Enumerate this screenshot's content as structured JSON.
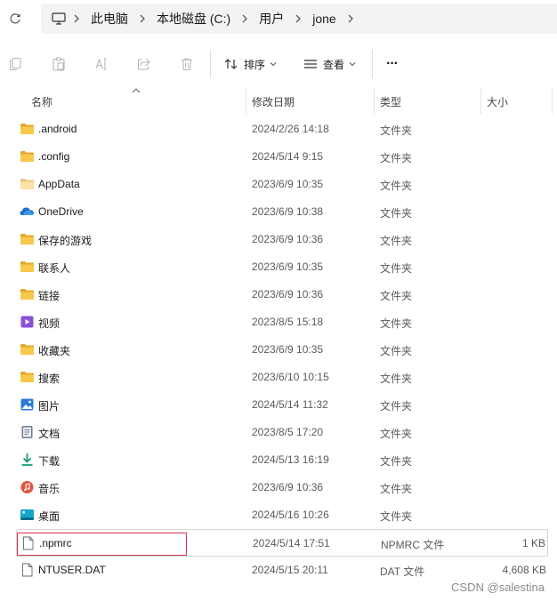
{
  "address_bar": {
    "crumbs": [
      "此电脑",
      "本地磁盘 (C:)",
      "用户",
      "jone"
    ]
  },
  "toolbar": {
    "sort_label": "排序",
    "view_label": "查看",
    "more_label": "···"
  },
  "columns": {
    "name": "名称",
    "date": "修改日期",
    "type": "类型",
    "size": "大小"
  },
  "files": [
    {
      "name": ".android",
      "date": "2024/2/26 14:18",
      "type": "文件夹",
      "size": "",
      "icon": "folder-icon"
    },
    {
      "name": ".config",
      "date": "2024/5/14 9:15",
      "type": "文件夹",
      "size": "",
      "icon": "folder-icon"
    },
    {
      "name": "AppData",
      "date": "2023/6/9 10:35",
      "type": "文件夹",
      "size": "",
      "icon": "folder-light-icon"
    },
    {
      "name": "OneDrive",
      "date": "2023/6/9 10:38",
      "type": "文件夹",
      "size": "",
      "icon": "onedrive-icon"
    },
    {
      "name": "保存的游戏",
      "date": "2023/6/9 10:36",
      "type": "文件夹",
      "size": "",
      "icon": "folder-icon"
    },
    {
      "name": "联系人",
      "date": "2023/6/9 10:35",
      "type": "文件夹",
      "size": "",
      "icon": "folder-icon"
    },
    {
      "name": "链接",
      "date": "2023/6/9 10:36",
      "type": "文件夹",
      "size": "",
      "icon": "folder-icon"
    },
    {
      "name": "视频",
      "date": "2023/8/5 15:18",
      "type": "文件夹",
      "size": "",
      "icon": "videos-icon"
    },
    {
      "name": "收藏夹",
      "date": "2023/6/9 10:35",
      "type": "文件夹",
      "size": "",
      "icon": "folder-icon"
    },
    {
      "name": "搜索",
      "date": "2023/6/10 10:15",
      "type": "文件夹",
      "size": "",
      "icon": "folder-icon"
    },
    {
      "name": "图片",
      "date": "2024/5/14 11:32",
      "type": "文件夹",
      "size": "",
      "icon": "pictures-icon"
    },
    {
      "name": "文档",
      "date": "2023/8/5 17:20",
      "type": "文件夹",
      "size": "",
      "icon": "documents-icon"
    },
    {
      "name": "下载",
      "date": "2024/5/13 16:19",
      "type": "文件夹",
      "size": "",
      "icon": "downloads-icon"
    },
    {
      "name": "音乐",
      "date": "2023/6/9 10:36",
      "type": "文件夹",
      "size": "",
      "icon": "music-icon"
    },
    {
      "name": "桌面",
      "date": "2024/5/16 10:26",
      "type": "文件夹",
      "size": "",
      "icon": "desktop-icon"
    },
    {
      "name": ".npmrc",
      "date": "2024/5/14 17:51",
      "type": "NPMRC 文件",
      "size": "1 KB",
      "icon": "file-icon"
    },
    {
      "name": "NTUSER.DAT",
      "date": "2024/5/15 20:11",
      "type": "DAT 文件",
      "size": "4,608 KB",
      "icon": "file-icon"
    }
  ],
  "watermark": "CSDN @salestina",
  "colors": {
    "folder": "#f2c14e",
    "folder_dark": "#e1a82a",
    "highlight_border": "#d8344e",
    "onedrive": "#1f6fd1"
  }
}
